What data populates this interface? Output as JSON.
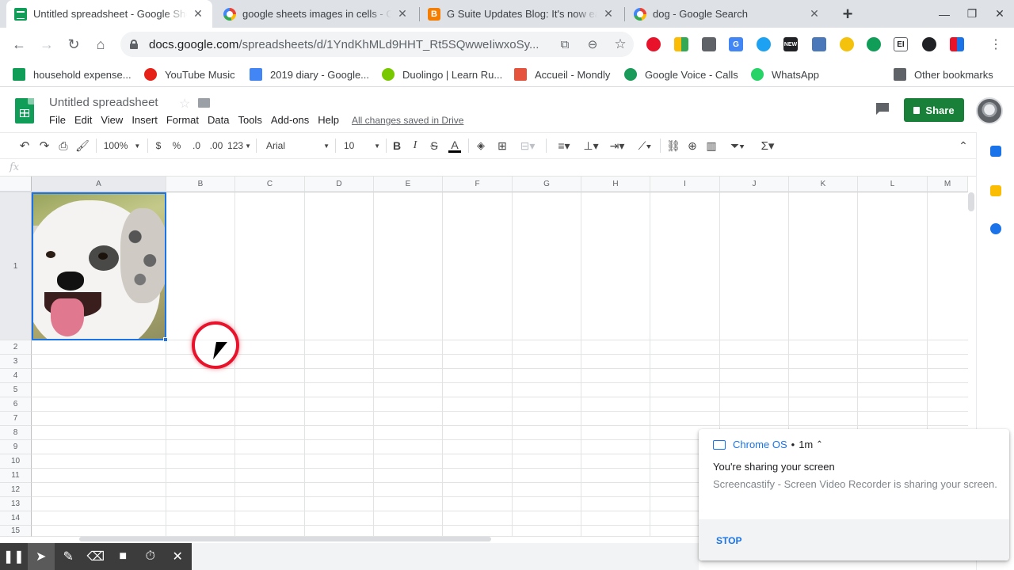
{
  "tabs": [
    {
      "title": "Untitled spreadsheet - Google Sheets",
      "favicon": "sheets-icon",
      "active": true
    },
    {
      "title": "google sheets images in cells - Google Search",
      "favicon": "google-icon",
      "active": false
    },
    {
      "title": "G Suite Updates Blog: It's now easier",
      "favicon": "blogger-icon",
      "active": false
    },
    {
      "title": "dog - Google Search",
      "favicon": "google-icon",
      "active": false
    }
  ],
  "address_bar": {
    "url_host": "docs.google.com",
    "url_path": "/spreadsheets/d/1YndKhMLd9HHT_Rt5SQwweIiwxoSy..."
  },
  "bookmarks": [
    {
      "label": "household expense...",
      "icon": "sheets-icon",
      "color": "#0f9d58"
    },
    {
      "label": "YouTube Music",
      "icon": "youtube-music-icon",
      "color": "#e62117"
    },
    {
      "label": "2019 diary - Google...",
      "icon": "docs-icon",
      "color": "#4285f4"
    },
    {
      "label": "Duolingo | Learn Ru...",
      "icon": "duolingo-icon",
      "color": "#78c800"
    },
    {
      "label": "Accueil - Mondly",
      "icon": "mondly-icon",
      "color": "#e5533d"
    },
    {
      "label": "Google Voice - Calls",
      "icon": "google-voice-icon",
      "color": "#1a9b5a"
    },
    {
      "label": "WhatsApp",
      "icon": "whatsapp-icon",
      "color": "#25d366"
    },
    {
      "label": "Other bookmarks",
      "icon": "folder-icon",
      "color": "#5f6368"
    }
  ],
  "sheet": {
    "title": "Untitled spreadsheet",
    "save_status": "All changes saved in Drive",
    "share_label": "Share"
  },
  "menu": [
    "File",
    "Edit",
    "View",
    "Insert",
    "Format",
    "Data",
    "Tools",
    "Add-ons",
    "Help"
  ],
  "format_toolbar": {
    "zoom": "100%",
    "currency": "$",
    "percent": "%",
    "decrease_decimal": ".0",
    "increase_decimal": ".00",
    "more_formats": "123",
    "font": "Arial",
    "font_size": "10",
    "bold": "B",
    "italic": "I",
    "strikethrough": "S",
    "text_color": "A"
  },
  "formula_bar": {
    "label": "fx",
    "value": ""
  },
  "columns": [
    "A",
    "B",
    "C",
    "D",
    "E",
    "F",
    "G",
    "H",
    "I",
    "J",
    "K",
    "L",
    "M"
  ],
  "rows": [
    "1",
    "2",
    "3",
    "4",
    "5",
    "6",
    "7",
    "8",
    "9",
    "10",
    "11",
    "12",
    "13",
    "14",
    "15"
  ],
  "selected_cell": "A1",
  "cell_a1_content": "dog-photo",
  "notification": {
    "source": "Chrome OS",
    "time": "1m",
    "title": "You're sharing your screen",
    "message": "Screencastify - Screen Video Recorder is sharing your screen.",
    "action": "STOP"
  },
  "accent_colors": {
    "sheets_green": "#0f9d58",
    "share_green": "#188038",
    "selection_blue": "#1a73e8",
    "cursor_highlight": "#e8132b"
  }
}
